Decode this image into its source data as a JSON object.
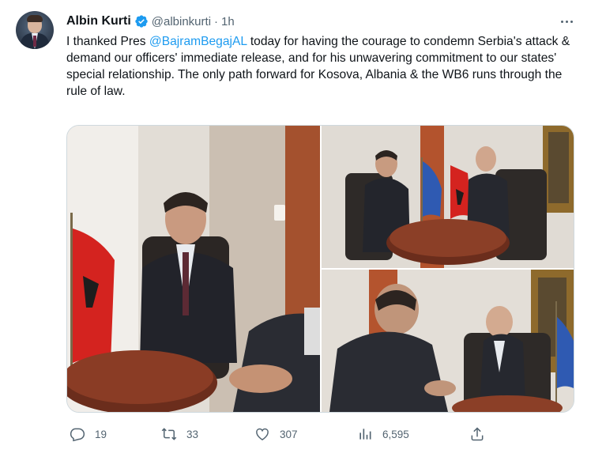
{
  "tweet": {
    "author_name": "Albin Kurti",
    "handle": "@albinkurti",
    "separator": "·",
    "time": "1h",
    "text_before": "I thanked Pres ",
    "mention": "@BajramBegajAL",
    "text_after": " today for having the courage to condemn Serbia's attack & demand our officers' immediate release, and for his unwavering commitment to our states' special relationship. The only path forward for Kosova, Albania & the WB6 runs through the rule of law."
  },
  "actions": {
    "replies": "19",
    "retweets": "33",
    "likes": "307",
    "views": "6,595"
  },
  "icons": {
    "verified": "verified-badge-icon",
    "more": "more-icon",
    "reply": "reply-icon",
    "retweet": "retweet-icon",
    "like": "heart-icon",
    "views": "views-icon",
    "share": "share-icon"
  },
  "colors": {
    "accent": "#1d9bf0",
    "secondary_text": "#536471",
    "text": "#0f1419",
    "border": "#cfd9de"
  }
}
